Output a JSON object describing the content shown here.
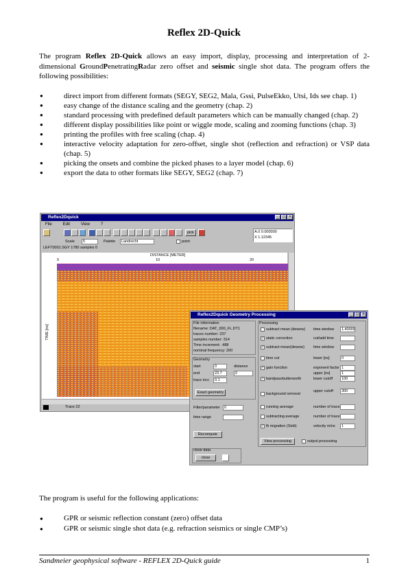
{
  "title": "Reflex 2D-Quick",
  "intro": {
    "p1": "The program ",
    "b1": "Reflex 2D-Quick",
    "p2": " allows an easy import, display, processing and interpretation of 2-dimensional ",
    "b2": "G",
    "p3": "round",
    "b3": "P",
    "p4": "enetrating",
    "b4": "R",
    "p5": "adar zero offset and ",
    "b5": "seismic",
    "p6": " single shot data. The program offers the following possibilities:"
  },
  "features": [
    "direct import from different formats (SEGY, SEG2, Mala, Gssi, PulseEkko, Utsi, Ids see chap. 1)",
    "easy change of the distance scaling and the geometry (chap. 2)",
    "standard processing with predefined default parameters which can be manually changed (chap. 2)",
    "different display possibilities like point or wiggle mode, scaling and zooming functions (chap. 3)",
    "printing the profiles with free scaling (chap. 4)",
    "interactive velocity adaptation for zero-offset, single shot (reflection and refraction) or VSP data (chap. 5)",
    "picking the onsets and combine the picked phases to a layer model (chap. 6)",
    "export the data to other formats like SEGY, SEG2 (chap. 7)"
  ],
  "screenshot": {
    "main_window": {
      "title": "Reflex2Dquick",
      "menu": [
        "File",
        "Edit",
        "View",
        "?"
      ],
      "scale_label": "Scale",
      "scale_value": "5",
      "palette_label": "Palette",
      "palette_value": "Landrecht",
      "wiggle_label": "point",
      "file_info": "LEFT0001.SGY 1780 samples 0",
      "axis_title": "DISTANCE [METER]",
      "time_axis_label": "TIME [ns]",
      "x_ticks": [
        "0",
        "10",
        "20"
      ],
      "status": "Trace 22",
      "pick_label": "pick",
      "side_values": [
        "A.0 0.000000",
        "X 1.12345"
      ]
    },
    "dialog": {
      "title": "Reflex2Dquick  Geometry  Processing",
      "file_info_header": "File information",
      "file_info": [
        "filename: DAT_000_FL.DT1",
        "traces number: 237",
        "samples number: 314",
        "Time increment: .488",
        "nominal frequency: 200"
      ],
      "geometry_header": "Geometry",
      "geometry_rows": [
        {
          "label": "start",
          "value": "0",
          "label2": "distance",
          "value2": "0"
        },
        {
          "label": "end",
          "value": "23.7",
          "label2": "",
          "value2": ""
        },
        {
          "label": "trace incr.",
          "value": "0.1",
          "label2": "",
          "value2": ""
        }
      ],
      "geometry_button": "Exact geometry",
      "filter_label": "Filter/parameter",
      "filter_value": "0",
      "time_label": "time range",
      "recompute_button": "Recompute",
      "processing_header": "Processing",
      "processing": [
        {
          "checked": false,
          "label": "subtract mean (dewow)",
          "p": "time window",
          "v": "1.40000"
        },
        {
          "checked": true,
          "label": "static correction",
          "p": "cut/add time",
          "v": ""
        },
        {
          "checked": true,
          "label": "subtract-mean(dewow)",
          "p": "time window",
          "v": ""
        },
        {
          "checked": false,
          "label": "time cut",
          "p": "lower [ns]",
          "v": "0"
        },
        {
          "checked": true,
          "label": "gain function",
          "p": "exponent factor",
          "v": "1"
        },
        {
          "checked": true,
          "label": "bandpassbutterworth",
          "p": "lower cutoff",
          "v": "100"
        },
        {
          "checked": false,
          "label": "background removal",
          "p": "",
          "v": ""
        },
        {
          "checked": false,
          "label": "running average",
          "p": "number of traces",
          "v": ""
        },
        {
          "checked": false,
          "label": "subtracting average",
          "p": "number of traces",
          "v": ""
        },
        {
          "checked": true,
          "label": "fk migration (Stolt)",
          "p": "velocity m/ns",
          "v": "1"
        }
      ],
      "upper_cutoff": "300",
      "upper_label": "upper cutoff",
      "upper_ns": "upper [ns]",
      "upper_ns_value": "1",
      "view_button": "View processing",
      "output_label": "output processing",
      "close_header": "close data",
      "close_button": "close"
    }
  },
  "applications_intro": "The program is useful for the following applications:",
  "applications": [
    "GPR or seismic reflection constant (zero) offset data",
    "GPR or seismic single shot data (e.g. refraction seismics or single CMP’s)"
  ],
  "footer": "Sandmeier geophysical software - REFLEX 2D-Quick guide",
  "page_number": "1",
  "colors": {
    "titlebar": "#000080",
    "window": "#c0c0c0",
    "radar_base": "#f0a020"
  }
}
